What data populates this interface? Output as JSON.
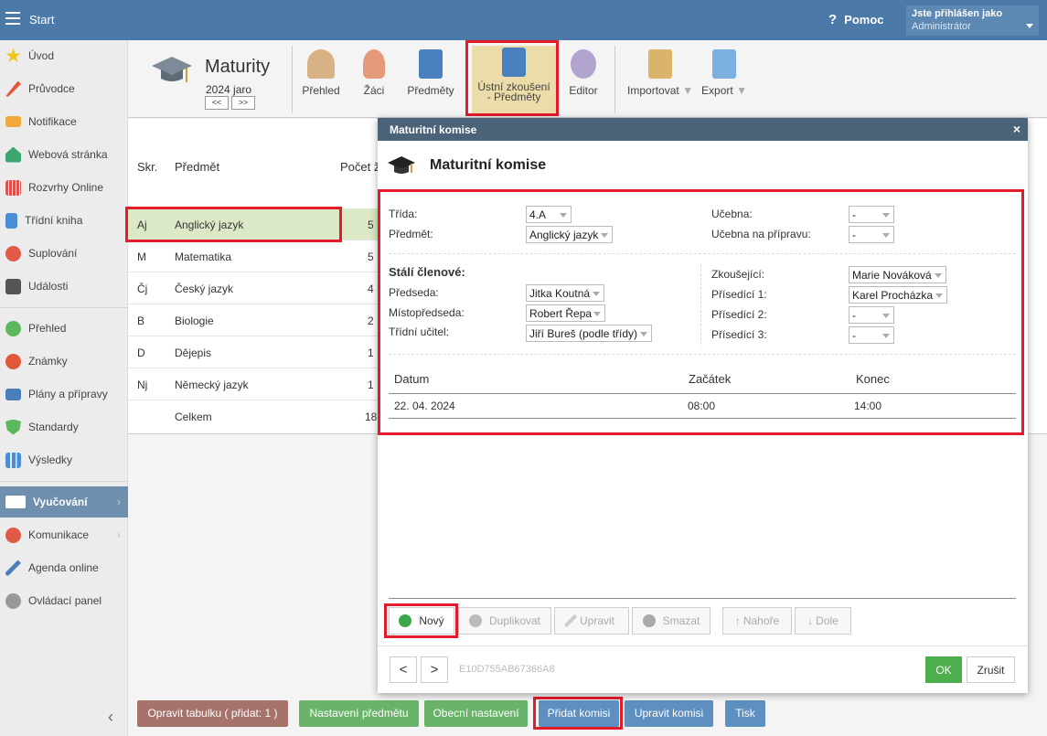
{
  "topbar": {
    "start": "Start",
    "help": "Pomoc",
    "user_line1": "Jste přihlášen jako",
    "user_line2": "Administrátor"
  },
  "sidebar": {
    "items": [
      "Úvod",
      "Průvodce",
      "Notifikace",
      "Webová stránka",
      "Rozvrhy Online",
      "Třídní kniha",
      "Suplování",
      "Události",
      "Přehled",
      "Známky",
      "Plány a přípravy",
      "Standardy",
      "Výsledky",
      "Vyučování",
      "Komunikace",
      "Agenda online",
      "Ovládací panel"
    ],
    "collapse": "‹"
  },
  "ribbon": {
    "title": "Maturity",
    "year": "2024 jaro",
    "prev": "<<",
    "next": ">>",
    "buttons": {
      "prehled": "Přehled",
      "zaci": "Žáci",
      "predmety": "Předměty",
      "ustni_1": "Ústní zkoušení",
      "ustni_2": "- Předměty",
      "editor": "Editor",
      "import": "Importovat",
      "export": "Export"
    }
  },
  "table": {
    "headers": {
      "skr": "Skr.",
      "predmet": "Předmět",
      "pocet": "Počet ž"
    },
    "rows": [
      {
        "skr": "Aj",
        "name": "Anglický jazyk",
        "count": "5"
      },
      {
        "skr": "M",
        "name": "Matematika",
        "count": "5"
      },
      {
        "skr": "Čj",
        "name": "Český jazyk",
        "count": "4"
      },
      {
        "skr": "B",
        "name": "Biologie",
        "count": "2"
      },
      {
        "skr": "D",
        "name": "Dějepis",
        "count": "1"
      },
      {
        "skr": "Nj",
        "name": "Německý jazyk",
        "count": "1"
      },
      {
        "skr": "",
        "name": "Celkem",
        "count": "18"
      }
    ]
  },
  "bottom": {
    "opravit": "Opravit tabulku ( přidat: 1 )",
    "nastaveni_predmetu": "Nastavení předmětu",
    "obecni": "Obecní nastavení",
    "pridat": "Přidat komisi",
    "upravit": "Upravit komisi",
    "tisk": "Tisk"
  },
  "modal": {
    "header": "Maturitní komise",
    "close": "×",
    "title": "Maturitní komise",
    "trida_label": "Třída:",
    "trida_value": "4.A",
    "predmet_label": "Předmět:",
    "predmet_value": "Anglický jazyk",
    "ucebna_label": "Učebna:",
    "ucebna_value": "-",
    "ucebna_priprava_label": "Učebna na přípravu:",
    "ucebna_priprava_value": "-",
    "stali_clenove": "Stálí členové:",
    "predseda_label": "Předseda:",
    "predseda_value": "Jitka Koutná",
    "mistopredseda_label": "Místopředseda:",
    "mistopredseda_value": "Robert Řepa",
    "tridni_label": "Třídní učitel:",
    "tridni_value": "Jiří Bureš (podle třídy)",
    "zkousejici_label": "Zkoušející:",
    "zkousejici_value": "Marie Nováková",
    "prisedici1_label": "Přísedící 1:",
    "prisedici1_value": "Karel Procházka",
    "prisedici2_label": "Přísedící 2:",
    "prisedici2_value": "-",
    "prisedici3_label": "Přísedící 3:",
    "prisedici3_value": "-",
    "schedule_headers": {
      "datum": "Datum",
      "zacatek": "Začátek",
      "konec": "Konec"
    },
    "schedule_row": {
      "datum": "22. 04. 2024",
      "zacatek": "08:00",
      "konec": "14:00"
    },
    "actions": {
      "novy": "Nový",
      "duplikovat": "Duplikovat",
      "upravit": "Upravit",
      "smazat": "Smazat",
      "nahore": "Nahoře",
      "dole": "Dole"
    },
    "prev": "<",
    "next": ">",
    "code": "E10D755AB67366A8",
    "ok": "OK",
    "zrusit": "Zrušit"
  },
  "colors": {
    "topbar": "#4b7aa8",
    "accent_red": "#e21c2b",
    "green": "#5cb85c",
    "blue_btn": "#5d8fc0",
    "brown_btn": "#a6736a"
  }
}
